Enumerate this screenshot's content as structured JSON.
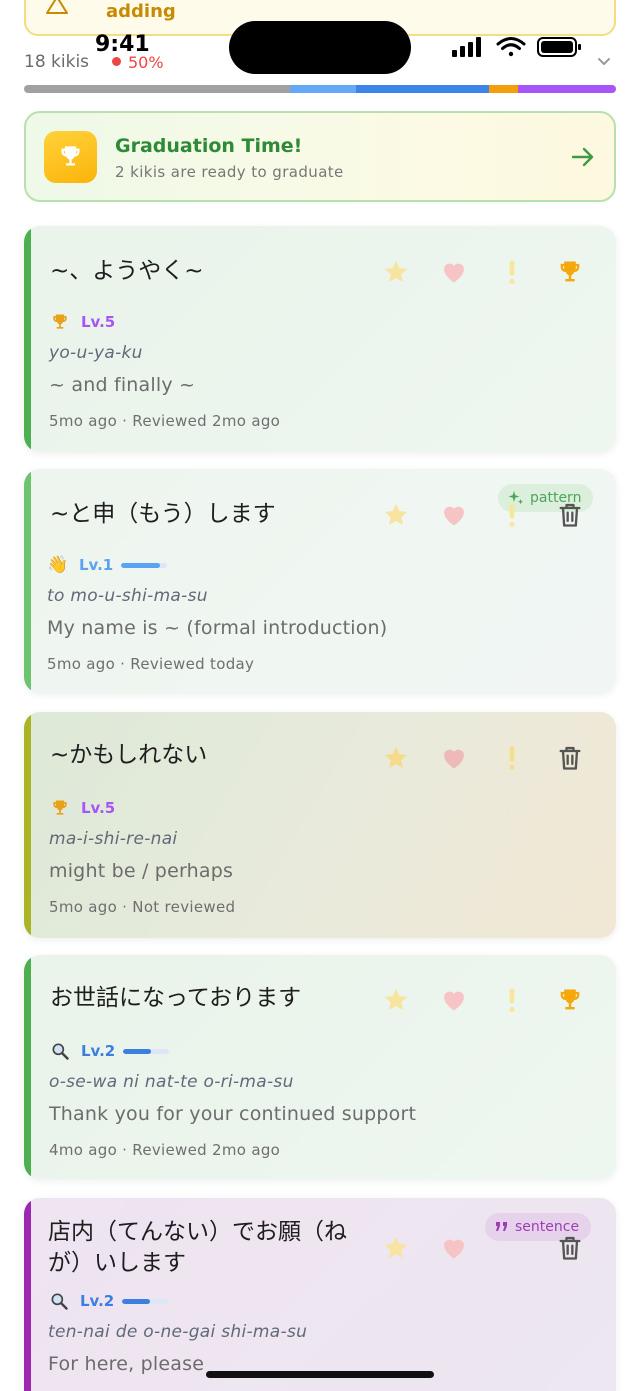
{
  "banner": {
    "text": "adding"
  },
  "status_bar": {
    "time": "9:41"
  },
  "header": {
    "kiki_count": "18 kikis",
    "record_percent": "50%"
  },
  "progress": {
    "segments": [
      {
        "fraction": 0.45,
        "color": "#a1a1a1"
      },
      {
        "fraction": 0.11,
        "color": "#65a8f5"
      },
      {
        "fraction": 0.225,
        "color": "#3d84e8"
      },
      {
        "fraction": 0.05,
        "color": "#f59e0b"
      },
      {
        "fraction": 0.165,
        "color": "#a855f7"
      }
    ]
  },
  "graduation": {
    "title": "Graduation Time!",
    "subtitle": "2 kikis are ready to graduate"
  },
  "cards": [
    {
      "word": "~、ようやく~",
      "level_icon": "trophy-icon",
      "level": "Lv.5",
      "romaji": "yo-u-ya-ku",
      "meaning": "~ and finally ~",
      "meta": "5mo ago · Reviewed 2mo ago",
      "accent": "#4caf50",
      "last_action": "trophy-icon"
    },
    {
      "word": "~と申（もう）します",
      "level_icon": "waving-hand-icon",
      "level": "Lv.1",
      "level_progress": 0.85,
      "romaji": "to mo-u-shi-ma-su",
      "meaning": "My name is ~ (formal introduction)",
      "meta": "5mo ago · Reviewed today",
      "accent": "#6cc46e",
      "tag": "pattern",
      "last_action": "trash-icon"
    },
    {
      "word": "~かもしれない",
      "level_icon": "trophy-icon",
      "level": "Lv.5",
      "romaji": "ma-i-shi-re-nai",
      "meaning": "might be / perhaps",
      "meta": "5mo ago · Not reviewed",
      "accent": "#aab526",
      "last_action": "trash-icon"
    },
    {
      "word": "お世話になっております",
      "level_icon": "magnifier-icon",
      "level": "Lv.2",
      "level_progress": 0.6,
      "romaji": "o-se-wa ni nat-te o-ri-ma-su",
      "meaning": "Thank you for your continued support",
      "meta": "4mo ago · Reviewed 2mo ago",
      "accent": "#4caf50",
      "last_action": "trophy-icon"
    },
    {
      "word_line1": "店内（てんない）でお願（ね",
      "word_line2": "が）いします",
      "level_icon": "magnifier-icon",
      "level": "Lv.2",
      "level_progress": 0.6,
      "romaji": "ten-nai de o-ne-gai shi-ma-su",
      "meaning": "For here, please",
      "accent": "#9c27b0",
      "tag": "sentence",
      "last_action": "trash-icon"
    }
  ],
  "colors": {
    "star": "#f7e4a0",
    "heart": "#f6c4c4",
    "exclamation": "#f8e79a",
    "trophy": "#f5a80b",
    "graduation_green": "#2e8a36",
    "lv5": "#a855f7",
    "lv1": "#5aa2f2",
    "lv2": "#3d7fe0"
  }
}
